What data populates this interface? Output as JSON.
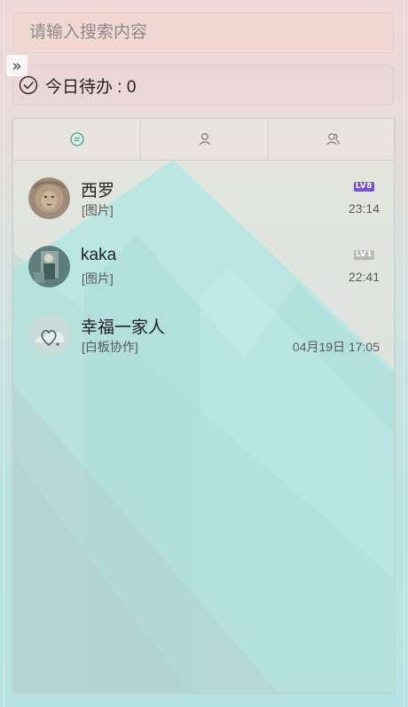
{
  "search": {
    "placeholder": "请输入搜索内容"
  },
  "expand_handle": {
    "glyph": "»"
  },
  "todo": {
    "label": "今日待办 : 0"
  },
  "tabs": [
    {
      "icon": "chat-bubble-icon",
      "active": true
    },
    {
      "icon": "person-icon",
      "active": false
    },
    {
      "icon": "group-icon",
      "active": false
    }
  ],
  "conversations": [
    {
      "name": "西罗",
      "preview": "[图片]",
      "time": "23:14",
      "level": "LV8",
      "level_color": "#7b4fd6",
      "avatar": "lion-avatar"
    },
    {
      "name": "kaka",
      "preview": "[图片]",
      "time": "22:41",
      "level": "LV1",
      "level_color": "#b8b8b8",
      "avatar": "photo-avatar"
    },
    {
      "name": "幸福一家人",
      "preview": "[白板协作]",
      "time": "04月19日 17:05",
      "level": "",
      "level_color": "",
      "avatar": "group-avatar"
    }
  ],
  "colors": {
    "accent_teal": "#3aa6a4",
    "mint_bg": "#b7e4e2",
    "peach_bg": "#efd9d6"
  }
}
